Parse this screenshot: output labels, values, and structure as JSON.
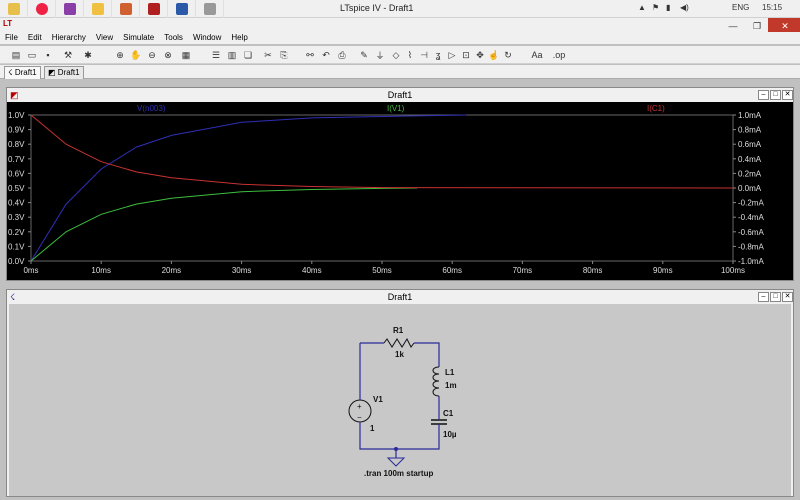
{
  "window": {
    "title": "LTspice IV - Draft1"
  },
  "tray": {
    "lang": "ENG",
    "time": "15:15"
  },
  "menu": [
    "File",
    "Edit",
    "Hierarchy",
    "View",
    "Simulate",
    "Tools",
    "Window",
    "Help"
  ],
  "tabs": [
    {
      "label": "Draft1",
      "icon": "schematic-icon"
    },
    {
      "label": "Draft1",
      "icon": "waveform-icon"
    }
  ],
  "wave_window": {
    "title": "Draft1"
  },
  "schematic_window": {
    "title": "Draft1"
  },
  "chart_data": {
    "type": "line",
    "title": "",
    "x_ticks": [
      "0ms",
      "10ms",
      "20ms",
      "30ms",
      "40ms",
      "50ms",
      "60ms",
      "70ms",
      "80ms",
      "90ms",
      "100ms"
    ],
    "y_left_ticks": [
      "1.0V",
      "0.9V",
      "0.8V",
      "0.7V",
      "0.6V",
      "0.5V",
      "0.4V",
      "0.3V",
      "0.2V",
      "0.1V",
      "0.0V"
    ],
    "y_right_ticks": [
      "1.0mA",
      "0.8mA",
      "0.6mA",
      "0.4mA",
      "0.2mA",
      "0.0mA",
      "-0.2mA",
      "-0.4mA",
      "-0.6mA",
      "-0.8mA",
      "-1.0mA"
    ],
    "xlim": [
      0,
      100
    ],
    "ylim_left": [
      0,
      1.0
    ],
    "ylim_right": [
      -1.0,
      1.0
    ],
    "grid": false,
    "series": [
      {
        "name": "V(n003)",
        "color": "#2f2fb8",
        "axis": "left",
        "x": [
          0,
          5,
          10,
          15,
          20,
          30,
          40,
          50,
          62
        ],
        "values": [
          0,
          0.39,
          0.63,
          0.78,
          0.86,
          0.95,
          0.98,
          0.99,
          1.0
        ]
      },
      {
        "name": "I(V1)",
        "color": "#3cbf3c",
        "axis": "left",
        "x": [
          0,
          5,
          10,
          15,
          20,
          30,
          40,
          50,
          55
        ],
        "values": [
          0,
          0.2,
          0.32,
          0.39,
          0.43,
          0.475,
          0.49,
          0.497,
          0.5
        ]
      },
      {
        "name": "I(C1)",
        "color": "#c83232",
        "axis": "left",
        "x": [
          0,
          5,
          10,
          15,
          20,
          30,
          40,
          50,
          100
        ],
        "values": [
          1.0,
          0.8,
          0.68,
          0.61,
          0.57,
          0.525,
          0.51,
          0.503,
          0.5
        ]
      }
    ]
  },
  "schematic": {
    "components": [
      {
        "ref": "R1",
        "value": "1k"
      },
      {
        "ref": "L1",
        "value": "1m"
      },
      {
        "ref": "V1",
        "value": "1"
      },
      {
        "ref": "C1",
        "value": "10µ"
      }
    ],
    "directive": ".tran 100m startup"
  }
}
